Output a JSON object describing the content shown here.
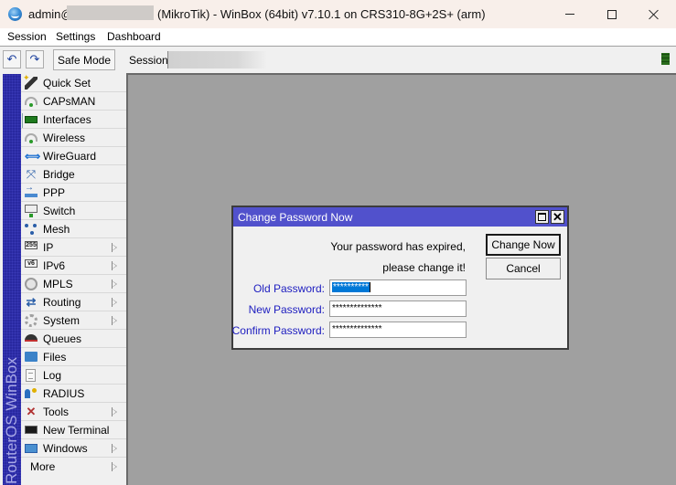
{
  "window": {
    "title_user": "admin@",
    "title_rest": "(MikroTik) - WinBox (64bit) v7.10.1 on CRS310-8G+2S+ (arm)",
    "controls": [
      "minimize",
      "maximize",
      "close"
    ]
  },
  "menubar": {
    "items": [
      "Session",
      "Settings",
      "Dashboard"
    ]
  },
  "toolbar": {
    "undo_icon": "undo-icon",
    "redo_icon": "redo-icon",
    "safe_mode_label": "Safe Mode",
    "session_label": "Session:",
    "status_color": "#2a6d1d"
  },
  "sidebar": {
    "brand": "RouterOS WinBox",
    "items": [
      {
        "label": "Quick Set",
        "icon": "wand-icon",
        "submenu": false
      },
      {
        "label": "CAPsMAN",
        "icon": "antenna-icon",
        "submenu": false
      },
      {
        "label": "Interfaces",
        "icon": "interface-card-icon",
        "submenu": false
      },
      {
        "label": "Wireless",
        "icon": "antenna-icon",
        "submenu": false
      },
      {
        "label": "WireGuard",
        "icon": "wireguard-icon",
        "submenu": false
      },
      {
        "label": "Bridge",
        "icon": "bridge-icon",
        "submenu": false
      },
      {
        "label": "PPP",
        "icon": "ppp-icon",
        "submenu": false
      },
      {
        "label": "Switch",
        "icon": "switch-icon",
        "submenu": false
      },
      {
        "label": "Mesh",
        "icon": "mesh-icon",
        "submenu": false
      },
      {
        "label": "IP",
        "icon": "ip-icon",
        "icon_text": "255",
        "submenu": true
      },
      {
        "label": "IPv6",
        "icon": "ipv6-icon",
        "icon_text": "v6",
        "submenu": true
      },
      {
        "label": "MPLS",
        "icon": "mpls-icon",
        "submenu": true
      },
      {
        "label": "Routing",
        "icon": "routing-icon",
        "submenu": true
      },
      {
        "label": "System",
        "icon": "gear-icon",
        "submenu": true
      },
      {
        "label": "Queues",
        "icon": "queues-icon",
        "submenu": false
      },
      {
        "label": "Files",
        "icon": "folder-icon",
        "submenu": false
      },
      {
        "label": "Log",
        "icon": "log-icon",
        "submenu": false
      },
      {
        "label": "RADIUS",
        "icon": "radius-icon",
        "submenu": false
      },
      {
        "label": "Tools",
        "icon": "tools-icon",
        "submenu": true
      },
      {
        "label": "New Terminal",
        "icon": "terminal-icon",
        "submenu": false
      },
      {
        "label": "Windows",
        "icon": "windows-icon",
        "submenu": true
      },
      {
        "label": "More",
        "icon": null,
        "submenu": true
      }
    ]
  },
  "dialog": {
    "title": "Change Password Now",
    "message_line1": "Your password has expired,",
    "message_line2": "please change it!",
    "fields": {
      "old": {
        "label": "Old Password:",
        "value": "**********"
      },
      "new": {
        "label": "New Password:",
        "value": "**************"
      },
      "confirm": {
        "label": "Confirm Password:",
        "value": "**************"
      }
    },
    "change_now_label": "Change Now",
    "cancel_label": "Cancel",
    "title_color": "#5151cc",
    "label_color": "#2020c0"
  }
}
